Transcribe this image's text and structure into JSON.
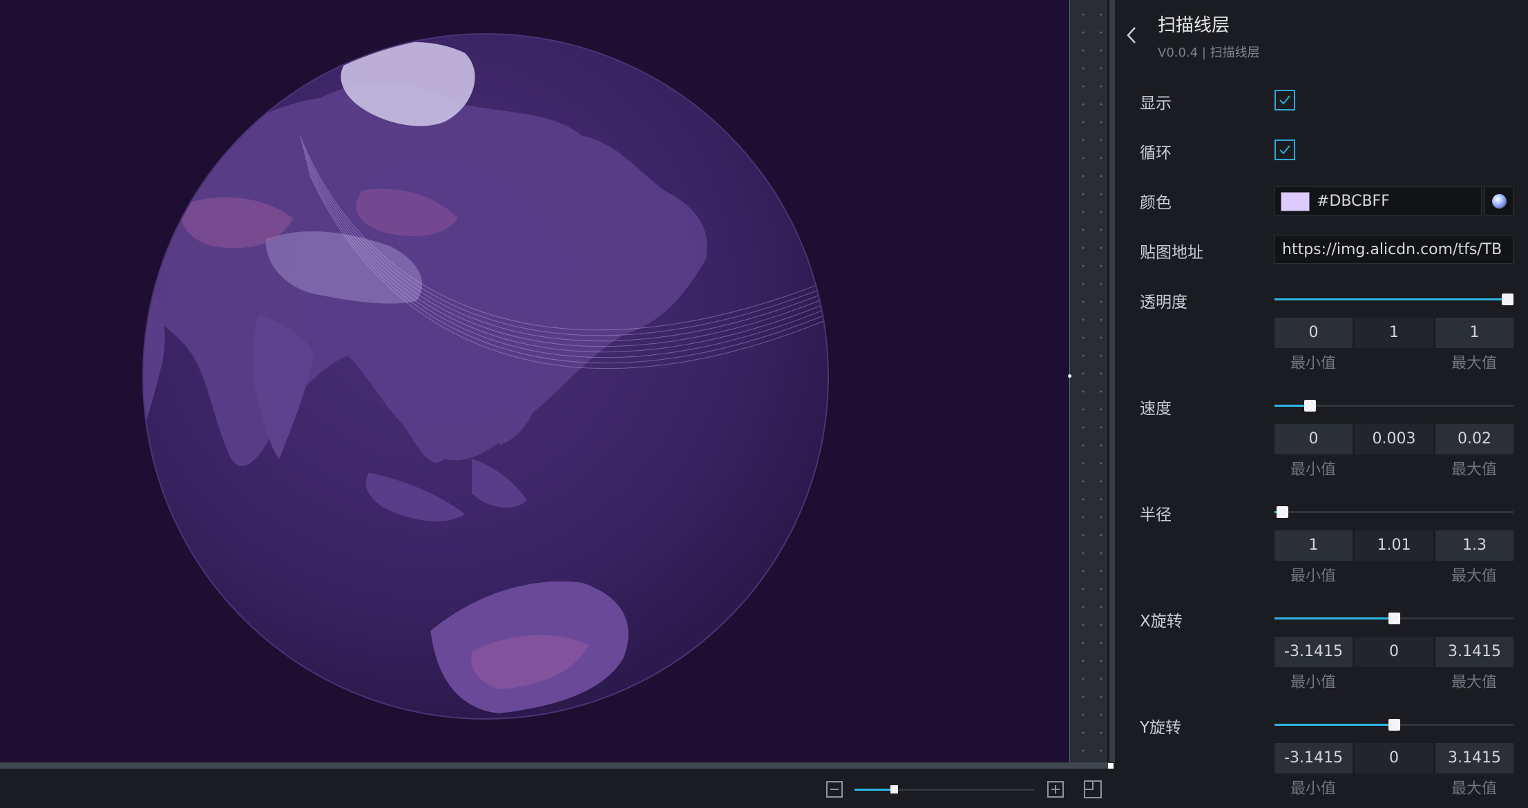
{
  "panel": {
    "title": "扫描线层",
    "subtitle": "V0.0.4 | 扫描线层",
    "back_icon": "chevron-left-icon"
  },
  "fields": {
    "show": {
      "label": "显示",
      "checked": true
    },
    "loop": {
      "label": "循环",
      "checked": true
    },
    "color": {
      "label": "颜色",
      "value": "#DBCBFF",
      "picker_icon": "color-wheel-icon"
    },
    "texture": {
      "label": "贴图地址",
      "value": "https://img.alicdn.com/tfs/TB"
    },
    "opacity": {
      "label": "透明度",
      "min": "0",
      "value": "1",
      "max": "1",
      "fraction": 1.0,
      "min_caption": "最小值",
      "max_caption": "最大值"
    },
    "speed": {
      "label": "速度",
      "min": "0",
      "value": "0.003",
      "max": "0.02",
      "fraction": 0.15,
      "min_caption": "最小值",
      "max_caption": "最大值"
    },
    "radius": {
      "label": "半径",
      "min": "1",
      "value": "1.01",
      "max": "1.3",
      "fraction": 0.033,
      "min_caption": "最小值",
      "max_caption": "最大值"
    },
    "x_rotation": {
      "label": "X旋转",
      "min": "-3.1415",
      "value": "0",
      "max": "3.1415",
      "fraction": 0.5,
      "min_caption": "最小值",
      "max_caption": "最大值"
    },
    "y_rotation": {
      "label": "Y旋转",
      "min": "-3.1415",
      "value": "0",
      "max": "3.1415",
      "fraction": 0.5,
      "min_caption": "最小值",
      "max_caption": "最大值"
    }
  },
  "canvas": {
    "background": "#1e0e31",
    "globe_color": "#3b2464",
    "land_color": "#5c3f8a",
    "scan_line_color": "#DBCBFF"
  },
  "zoom": {
    "level_fraction": 0.22,
    "zoom_out_icon": "zoom-out-icon",
    "zoom_in_icon": "zoom-in-icon",
    "fit_icon": "fit-screen-icon"
  },
  "accent": "#2fb6e6"
}
